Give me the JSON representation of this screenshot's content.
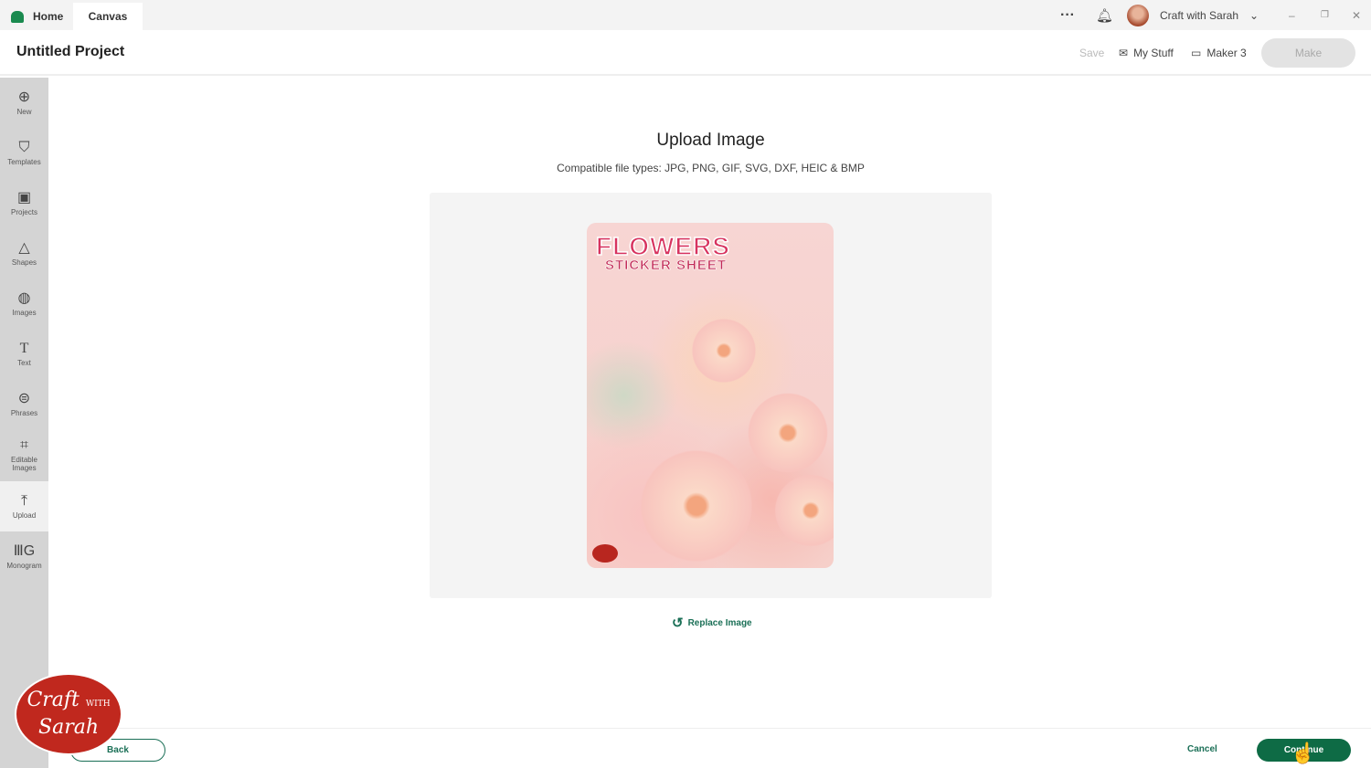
{
  "tabs": [
    {
      "label": "Home"
    },
    {
      "label": "Canvas"
    }
  ],
  "account": {
    "name": "Craft with Sarah"
  },
  "window_controls": [
    "minimize",
    "restore",
    "close"
  ],
  "header": {
    "title": "Untitled Project",
    "save": "Save",
    "my_stuff": "My Stuff",
    "machine": "Maker 3",
    "make": "Make"
  },
  "sidebar": {
    "items": [
      {
        "label": "New",
        "icon": "plus-circle-icon"
      },
      {
        "label": "Templates",
        "icon": "shirt-icon"
      },
      {
        "label": "Projects",
        "icon": "clipboard-icon"
      },
      {
        "label": "Shapes",
        "icon": "shapes-icon"
      },
      {
        "label": "Images",
        "icon": "bulb-icon"
      },
      {
        "label": "Text",
        "icon": "text-icon"
      },
      {
        "label": "Phrases",
        "icon": "speech-bubble-icon"
      },
      {
        "label": "Editable Images",
        "icon": "editable-image-icon"
      },
      {
        "label": "Upload",
        "icon": "upload-icon",
        "active": true
      },
      {
        "label": "Monogram",
        "icon": "monogram-icon"
      }
    ]
  },
  "main": {
    "title": "Upload Image",
    "subtitle": "Compatible file types:  JPG, PNG, GIF, SVG, DXF, HEIC & BMP",
    "preview": {
      "title": "FLOWERS",
      "subtitle": "STICKER SHEET"
    },
    "replace": "Replace Image"
  },
  "footer": {
    "back": "Back",
    "cancel": "Cancel",
    "continue": "Continue"
  },
  "watermark": {
    "line1": "Craft",
    "line2": "Sarah",
    "small": "WITH"
  },
  "colors": {
    "accent": "#0e6b45",
    "sidebar": "#d4d4d4"
  }
}
